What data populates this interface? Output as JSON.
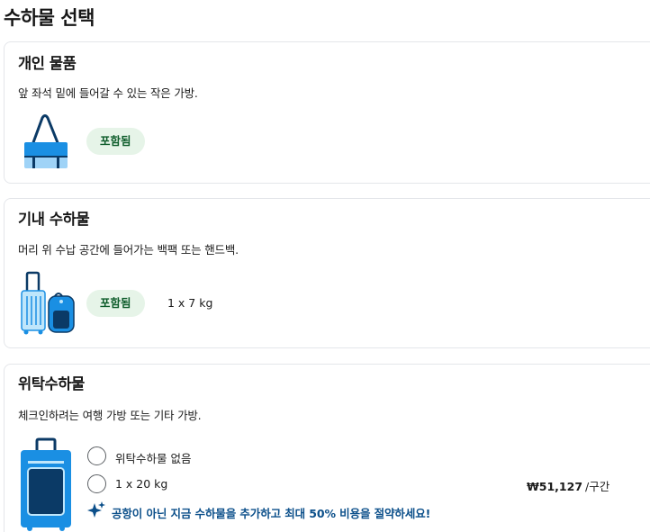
{
  "page": {
    "title": "수하물 선택"
  },
  "cards": {
    "personal": {
      "title": "개인 물품",
      "description": "앞 좌석 밑에 들어갈 수 있는 작은 가방.",
      "badge": "포함됨",
      "icon": "shoulder-bag-icon"
    },
    "carry_on": {
      "title": "기내 수하물",
      "description": "머리 위 수납 공간에 들어가는 백팩 또는 핸드백.",
      "badge": "포함됨",
      "weight": "1 x 7 kg",
      "icon": "carry-on-suitcase-backpack-icon"
    },
    "checked": {
      "title": "위탁수하물",
      "description": "체크인하려는 여행 가방 또는 기타 가방.",
      "icon": "checked-suitcase-icon",
      "options": [
        {
          "label": "위탁수하물 없음",
          "selected": false
        },
        {
          "label": "1 x 20 kg",
          "selected": false,
          "price": "₩51,127",
          "price_unit": "/구간"
        }
      ],
      "promo": {
        "icon": "sparkle-icon",
        "text": "공항이 아닌 지금 수하물을 추가하고 최대 50% 비용을 절약하세요!"
      }
    }
  },
  "colors": {
    "badge_bg": "#e6f4e8",
    "badge_text": "#0d5c2a",
    "promo_text": "#0b4f8a",
    "bag_blue": "#1a8fe3",
    "bag_dark": "#0b3a66"
  }
}
